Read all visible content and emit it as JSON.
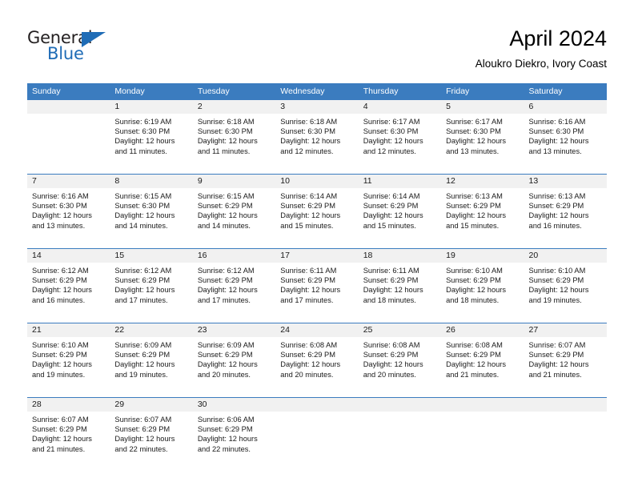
{
  "brand": {
    "name_part1": "General",
    "name_part2": "Blue",
    "accent_color": "#1f6cb6",
    "triangle_icon": "triangle-icon"
  },
  "header": {
    "title": "April 2024",
    "subtitle": "Aloukro Diekro, Ivory Coast"
  },
  "calendar": {
    "header_bg": "#3b7cbf",
    "daynum_bg": "#f1f1f1",
    "weekdays": [
      "Sunday",
      "Monday",
      "Tuesday",
      "Wednesday",
      "Thursday",
      "Friday",
      "Saturday"
    ],
    "weeks": [
      {
        "days": [
          {
            "num": "",
            "sunrise": "",
            "sunset": "",
            "daylight": ""
          },
          {
            "num": "1",
            "sunrise": "Sunrise: 6:19 AM",
            "sunset": "Sunset: 6:30 PM",
            "daylight": "Daylight: 12 hours and 11 minutes."
          },
          {
            "num": "2",
            "sunrise": "Sunrise: 6:18 AM",
            "sunset": "Sunset: 6:30 PM",
            "daylight": "Daylight: 12 hours and 11 minutes."
          },
          {
            "num": "3",
            "sunrise": "Sunrise: 6:18 AM",
            "sunset": "Sunset: 6:30 PM",
            "daylight": "Daylight: 12 hours and 12 minutes."
          },
          {
            "num": "4",
            "sunrise": "Sunrise: 6:17 AM",
            "sunset": "Sunset: 6:30 PM",
            "daylight": "Daylight: 12 hours and 12 minutes."
          },
          {
            "num": "5",
            "sunrise": "Sunrise: 6:17 AM",
            "sunset": "Sunset: 6:30 PM",
            "daylight": "Daylight: 12 hours and 13 minutes."
          },
          {
            "num": "6",
            "sunrise": "Sunrise: 6:16 AM",
            "sunset": "Sunset: 6:30 PM",
            "daylight": "Daylight: 12 hours and 13 minutes."
          }
        ]
      },
      {
        "days": [
          {
            "num": "7",
            "sunrise": "Sunrise: 6:16 AM",
            "sunset": "Sunset: 6:30 PM",
            "daylight": "Daylight: 12 hours and 13 minutes."
          },
          {
            "num": "8",
            "sunrise": "Sunrise: 6:15 AM",
            "sunset": "Sunset: 6:30 PM",
            "daylight": "Daylight: 12 hours and 14 minutes."
          },
          {
            "num": "9",
            "sunrise": "Sunrise: 6:15 AM",
            "sunset": "Sunset: 6:29 PM",
            "daylight": "Daylight: 12 hours and 14 minutes."
          },
          {
            "num": "10",
            "sunrise": "Sunrise: 6:14 AM",
            "sunset": "Sunset: 6:29 PM",
            "daylight": "Daylight: 12 hours and 15 minutes."
          },
          {
            "num": "11",
            "sunrise": "Sunrise: 6:14 AM",
            "sunset": "Sunset: 6:29 PM",
            "daylight": "Daylight: 12 hours and 15 minutes."
          },
          {
            "num": "12",
            "sunrise": "Sunrise: 6:13 AM",
            "sunset": "Sunset: 6:29 PM",
            "daylight": "Daylight: 12 hours and 15 minutes."
          },
          {
            "num": "13",
            "sunrise": "Sunrise: 6:13 AM",
            "sunset": "Sunset: 6:29 PM",
            "daylight": "Daylight: 12 hours and 16 minutes."
          }
        ]
      },
      {
        "days": [
          {
            "num": "14",
            "sunrise": "Sunrise: 6:12 AM",
            "sunset": "Sunset: 6:29 PM",
            "daylight": "Daylight: 12 hours and 16 minutes."
          },
          {
            "num": "15",
            "sunrise": "Sunrise: 6:12 AM",
            "sunset": "Sunset: 6:29 PM",
            "daylight": "Daylight: 12 hours and 17 minutes."
          },
          {
            "num": "16",
            "sunrise": "Sunrise: 6:12 AM",
            "sunset": "Sunset: 6:29 PM",
            "daylight": "Daylight: 12 hours and 17 minutes."
          },
          {
            "num": "17",
            "sunrise": "Sunrise: 6:11 AM",
            "sunset": "Sunset: 6:29 PM",
            "daylight": "Daylight: 12 hours and 17 minutes."
          },
          {
            "num": "18",
            "sunrise": "Sunrise: 6:11 AM",
            "sunset": "Sunset: 6:29 PM",
            "daylight": "Daylight: 12 hours and 18 minutes."
          },
          {
            "num": "19",
            "sunrise": "Sunrise: 6:10 AM",
            "sunset": "Sunset: 6:29 PM",
            "daylight": "Daylight: 12 hours and 18 minutes."
          },
          {
            "num": "20",
            "sunrise": "Sunrise: 6:10 AM",
            "sunset": "Sunset: 6:29 PM",
            "daylight": "Daylight: 12 hours and 19 minutes."
          }
        ]
      },
      {
        "days": [
          {
            "num": "21",
            "sunrise": "Sunrise: 6:10 AM",
            "sunset": "Sunset: 6:29 PM",
            "daylight": "Daylight: 12 hours and 19 minutes."
          },
          {
            "num": "22",
            "sunrise": "Sunrise: 6:09 AM",
            "sunset": "Sunset: 6:29 PM",
            "daylight": "Daylight: 12 hours and 19 minutes."
          },
          {
            "num": "23",
            "sunrise": "Sunrise: 6:09 AM",
            "sunset": "Sunset: 6:29 PM",
            "daylight": "Daylight: 12 hours and 20 minutes."
          },
          {
            "num": "24",
            "sunrise": "Sunrise: 6:08 AM",
            "sunset": "Sunset: 6:29 PM",
            "daylight": "Daylight: 12 hours and 20 minutes."
          },
          {
            "num": "25",
            "sunrise": "Sunrise: 6:08 AM",
            "sunset": "Sunset: 6:29 PM",
            "daylight": "Daylight: 12 hours and 20 minutes."
          },
          {
            "num": "26",
            "sunrise": "Sunrise: 6:08 AM",
            "sunset": "Sunset: 6:29 PM",
            "daylight": "Daylight: 12 hours and 21 minutes."
          },
          {
            "num": "27",
            "sunrise": "Sunrise: 6:07 AM",
            "sunset": "Sunset: 6:29 PM",
            "daylight": "Daylight: 12 hours and 21 minutes."
          }
        ]
      },
      {
        "days": [
          {
            "num": "28",
            "sunrise": "Sunrise: 6:07 AM",
            "sunset": "Sunset: 6:29 PM",
            "daylight": "Daylight: 12 hours and 21 minutes."
          },
          {
            "num": "29",
            "sunrise": "Sunrise: 6:07 AM",
            "sunset": "Sunset: 6:29 PM",
            "daylight": "Daylight: 12 hours and 22 minutes."
          },
          {
            "num": "30",
            "sunrise": "Sunrise: 6:06 AM",
            "sunset": "Sunset: 6:29 PM",
            "daylight": "Daylight: 12 hours and 22 minutes."
          },
          {
            "num": "",
            "sunrise": "",
            "sunset": "",
            "daylight": ""
          },
          {
            "num": "",
            "sunrise": "",
            "sunset": "",
            "daylight": ""
          },
          {
            "num": "",
            "sunrise": "",
            "sunset": "",
            "daylight": ""
          },
          {
            "num": "",
            "sunrise": "",
            "sunset": "",
            "daylight": ""
          }
        ]
      }
    ]
  }
}
